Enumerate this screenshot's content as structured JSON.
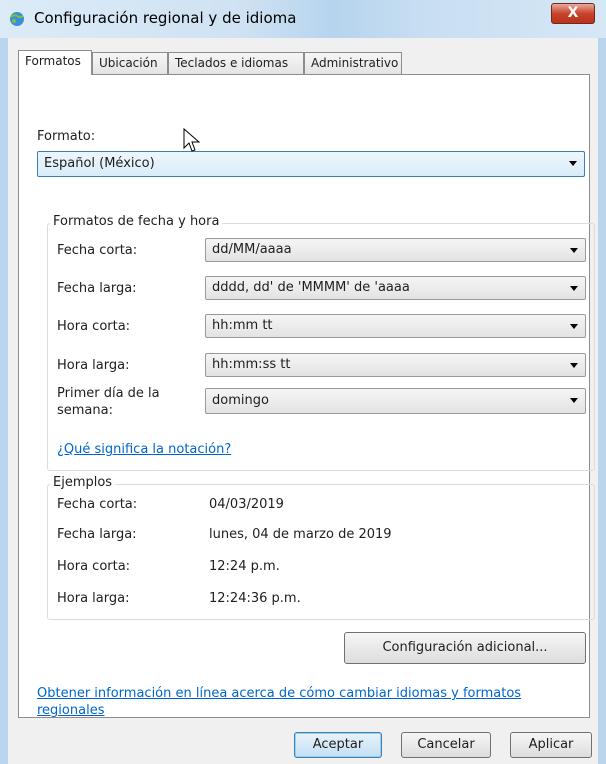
{
  "window": {
    "title": "Configuración regional y de idioma",
    "close_label": "X"
  },
  "tabs": [
    {
      "label": "Formatos",
      "active": true
    },
    {
      "label": "Ubicación",
      "active": false
    },
    {
      "label": "Teclados e idiomas",
      "active": false
    },
    {
      "label": "Administrativo",
      "active": false
    }
  ],
  "format": {
    "label": "Formato:",
    "value": "Español (México)"
  },
  "date_time": {
    "group_title": "Formatos de fecha y hora",
    "rows": [
      {
        "label": "Fecha corta:",
        "value": "dd/MM/aaaa"
      },
      {
        "label": "Fecha larga:",
        "value": "dddd, dd' de 'MMMM' de 'aaaa"
      },
      {
        "label": "Hora corta:",
        "value": "hh:mm tt"
      },
      {
        "label": "Hora larga:",
        "value": "hh:mm:ss tt"
      },
      {
        "label": "Primer día de la",
        "label2": "semana:",
        "value": "domingo"
      }
    ],
    "notation_link": "¿Qué significa la notación?"
  },
  "examples": {
    "group_title": "Ejemplos",
    "rows": [
      {
        "label": "Fecha corta:",
        "value": "04/03/2019"
      },
      {
        "label": "Fecha larga:",
        "value": "lunes, 04 de marzo de 2019"
      },
      {
        "label": "Hora corta:",
        "value": "12:24 p.m."
      },
      {
        "label": "Hora larga:",
        "value": "12:24:36 p.m."
      }
    ]
  },
  "additional_button": "Configuración adicional...",
  "online_link": {
    "line1": "Obtener información en línea acerca de cómo cambiar idiomas y formatos",
    "line2": "regionales"
  },
  "footer": {
    "ok": "Aceptar",
    "cancel": "Cancelar",
    "apply": "Aplicar"
  },
  "colors": {
    "link": "#0066cc",
    "title_bar": "#cfe2f3",
    "close": "#c8432c"
  }
}
